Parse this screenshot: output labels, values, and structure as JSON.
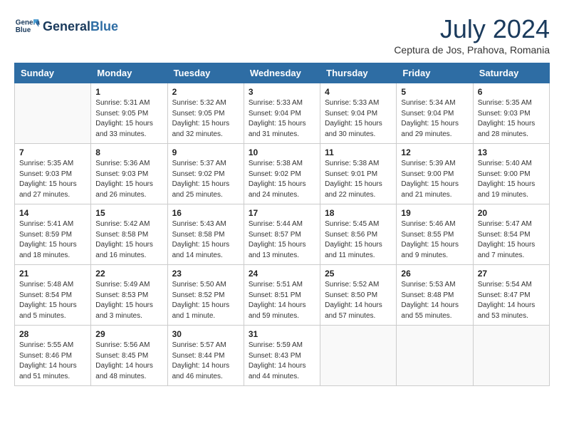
{
  "header": {
    "logo_line1": "General",
    "logo_line2": "Blue",
    "month_year": "July 2024",
    "location": "Ceptura de Jos, Prahova, Romania"
  },
  "weekdays": [
    "Sunday",
    "Monday",
    "Tuesday",
    "Wednesday",
    "Thursday",
    "Friday",
    "Saturday"
  ],
  "weeks": [
    [
      {
        "day": "",
        "info": ""
      },
      {
        "day": "1",
        "info": "Sunrise: 5:31 AM\nSunset: 9:05 PM\nDaylight: 15 hours\nand 33 minutes."
      },
      {
        "day": "2",
        "info": "Sunrise: 5:32 AM\nSunset: 9:05 PM\nDaylight: 15 hours\nand 32 minutes."
      },
      {
        "day": "3",
        "info": "Sunrise: 5:33 AM\nSunset: 9:04 PM\nDaylight: 15 hours\nand 31 minutes."
      },
      {
        "day": "4",
        "info": "Sunrise: 5:33 AM\nSunset: 9:04 PM\nDaylight: 15 hours\nand 30 minutes."
      },
      {
        "day": "5",
        "info": "Sunrise: 5:34 AM\nSunset: 9:04 PM\nDaylight: 15 hours\nand 29 minutes."
      },
      {
        "day": "6",
        "info": "Sunrise: 5:35 AM\nSunset: 9:03 PM\nDaylight: 15 hours\nand 28 minutes."
      }
    ],
    [
      {
        "day": "7",
        "info": "Sunrise: 5:35 AM\nSunset: 9:03 PM\nDaylight: 15 hours\nand 27 minutes."
      },
      {
        "day": "8",
        "info": "Sunrise: 5:36 AM\nSunset: 9:03 PM\nDaylight: 15 hours\nand 26 minutes."
      },
      {
        "day": "9",
        "info": "Sunrise: 5:37 AM\nSunset: 9:02 PM\nDaylight: 15 hours\nand 25 minutes."
      },
      {
        "day": "10",
        "info": "Sunrise: 5:38 AM\nSunset: 9:02 PM\nDaylight: 15 hours\nand 24 minutes."
      },
      {
        "day": "11",
        "info": "Sunrise: 5:38 AM\nSunset: 9:01 PM\nDaylight: 15 hours\nand 22 minutes."
      },
      {
        "day": "12",
        "info": "Sunrise: 5:39 AM\nSunset: 9:00 PM\nDaylight: 15 hours\nand 21 minutes."
      },
      {
        "day": "13",
        "info": "Sunrise: 5:40 AM\nSunset: 9:00 PM\nDaylight: 15 hours\nand 19 minutes."
      }
    ],
    [
      {
        "day": "14",
        "info": "Sunrise: 5:41 AM\nSunset: 8:59 PM\nDaylight: 15 hours\nand 18 minutes."
      },
      {
        "day": "15",
        "info": "Sunrise: 5:42 AM\nSunset: 8:58 PM\nDaylight: 15 hours\nand 16 minutes."
      },
      {
        "day": "16",
        "info": "Sunrise: 5:43 AM\nSunset: 8:58 PM\nDaylight: 15 hours\nand 14 minutes."
      },
      {
        "day": "17",
        "info": "Sunrise: 5:44 AM\nSunset: 8:57 PM\nDaylight: 15 hours\nand 13 minutes."
      },
      {
        "day": "18",
        "info": "Sunrise: 5:45 AM\nSunset: 8:56 PM\nDaylight: 15 hours\nand 11 minutes."
      },
      {
        "day": "19",
        "info": "Sunrise: 5:46 AM\nSunset: 8:55 PM\nDaylight: 15 hours\nand 9 minutes."
      },
      {
        "day": "20",
        "info": "Sunrise: 5:47 AM\nSunset: 8:54 PM\nDaylight: 15 hours\nand 7 minutes."
      }
    ],
    [
      {
        "day": "21",
        "info": "Sunrise: 5:48 AM\nSunset: 8:54 PM\nDaylight: 15 hours\nand 5 minutes."
      },
      {
        "day": "22",
        "info": "Sunrise: 5:49 AM\nSunset: 8:53 PM\nDaylight: 15 hours\nand 3 minutes."
      },
      {
        "day": "23",
        "info": "Sunrise: 5:50 AM\nSunset: 8:52 PM\nDaylight: 15 hours\nand 1 minute."
      },
      {
        "day": "24",
        "info": "Sunrise: 5:51 AM\nSunset: 8:51 PM\nDaylight: 14 hours\nand 59 minutes."
      },
      {
        "day": "25",
        "info": "Sunrise: 5:52 AM\nSunset: 8:50 PM\nDaylight: 14 hours\nand 57 minutes."
      },
      {
        "day": "26",
        "info": "Sunrise: 5:53 AM\nSunset: 8:48 PM\nDaylight: 14 hours\nand 55 minutes."
      },
      {
        "day": "27",
        "info": "Sunrise: 5:54 AM\nSunset: 8:47 PM\nDaylight: 14 hours\nand 53 minutes."
      }
    ],
    [
      {
        "day": "28",
        "info": "Sunrise: 5:55 AM\nSunset: 8:46 PM\nDaylight: 14 hours\nand 51 minutes."
      },
      {
        "day": "29",
        "info": "Sunrise: 5:56 AM\nSunset: 8:45 PM\nDaylight: 14 hours\nand 48 minutes."
      },
      {
        "day": "30",
        "info": "Sunrise: 5:57 AM\nSunset: 8:44 PM\nDaylight: 14 hours\nand 46 minutes."
      },
      {
        "day": "31",
        "info": "Sunrise: 5:59 AM\nSunset: 8:43 PM\nDaylight: 14 hours\nand 44 minutes."
      },
      {
        "day": "",
        "info": ""
      },
      {
        "day": "",
        "info": ""
      },
      {
        "day": "",
        "info": ""
      }
    ]
  ]
}
